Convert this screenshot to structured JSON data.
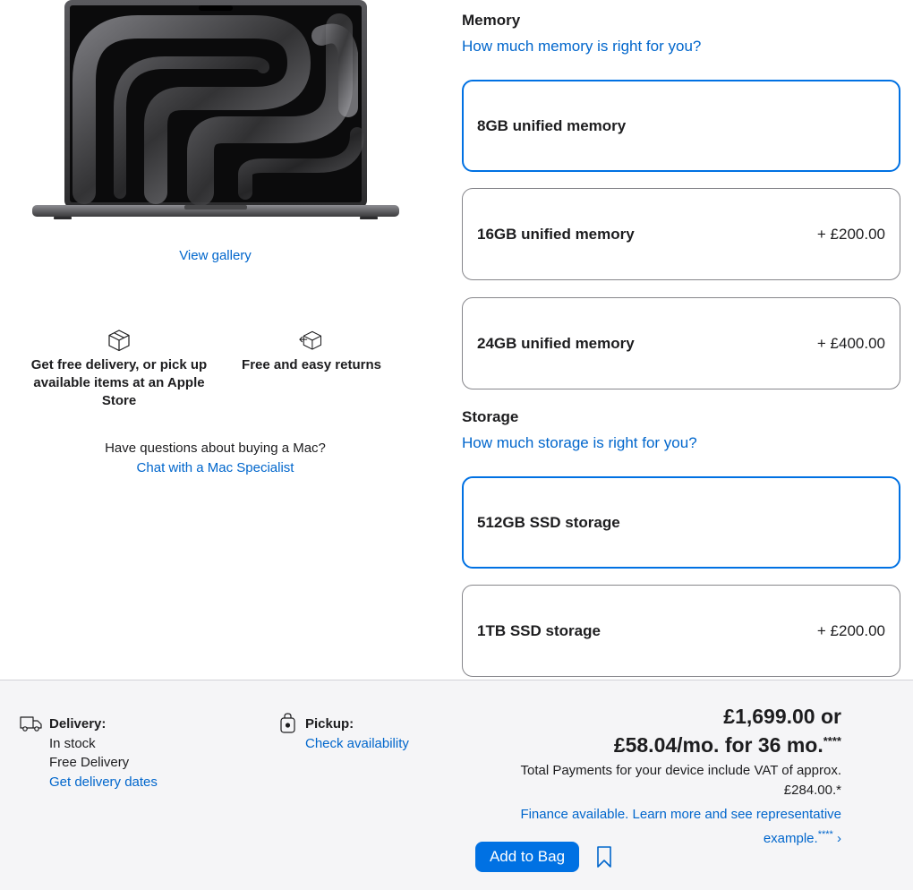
{
  "gallery": {
    "view_label": "View gallery"
  },
  "benefits": [
    {
      "icon": "package-icon",
      "label": "Get free delivery, or pick up available items at an Apple Store"
    },
    {
      "icon": "return-package-icon",
      "label": "Free and easy returns"
    }
  ],
  "help": {
    "question": "Have questions about buying a Mac?",
    "link": "Chat with a Mac Specialist"
  },
  "memory": {
    "title": "Memory",
    "help_link": "How much memory is right for you?",
    "options": [
      {
        "label": "8GB unified memory",
        "price": "",
        "selected": true
      },
      {
        "label": "16GB unified memory",
        "price": "+ £200.00",
        "selected": false
      },
      {
        "label": "24GB unified memory",
        "price": "+ £400.00",
        "selected": false
      }
    ]
  },
  "storage": {
    "title": "Storage",
    "help_link": "How much storage is right for you?",
    "options": [
      {
        "label": "512GB SSD storage",
        "price": "",
        "selected": true
      },
      {
        "label": "1TB SSD storage",
        "price": "+ £200.00",
        "selected": false
      }
    ]
  },
  "delivery": {
    "icon": "truck-icon",
    "title": "Delivery:",
    "stock": "In stock",
    "type": "Free Delivery",
    "link": "Get delivery dates"
  },
  "pickup": {
    "icon": "store-bag-icon",
    "title": "Pickup:",
    "link": "Check availability"
  },
  "price": {
    "line1": "£1,699.00 or",
    "line2": "£58.04/mo. for 36 mo.",
    "line2_mark": "****",
    "vat_line1": "Total Payments for your device include VAT of approx.",
    "vat_line2": "£284.00.*",
    "finance_line1": "Finance available. Learn more and see representative",
    "finance_line2": "example.",
    "finance_mark": "****",
    "finance_chevron": "›"
  },
  "actions": {
    "add_to_bag": "Add to Bag",
    "bookmark_icon": "bookmark-icon"
  },
  "colors": {
    "accent": "#0071e3",
    "link": "#0066cc",
    "bar_bg": "#f5f5f7"
  }
}
